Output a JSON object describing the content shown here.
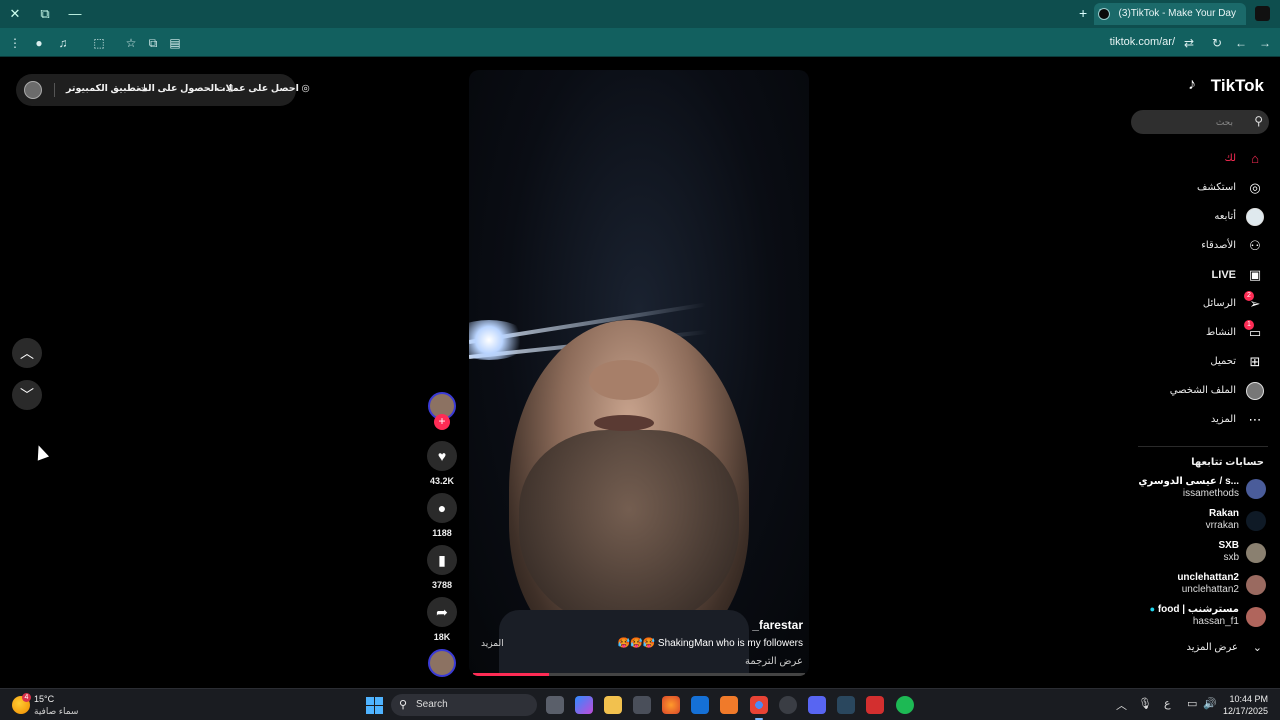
{
  "browser": {
    "tab_title": "(3)TikTok - Make Your Day",
    "url": "tiktok.com/ar/"
  },
  "topbar": {
    "promo_coins": "احصل على عملات",
    "promo_get_app": "الحصول على الت...",
    "promo_pc_app": "تطبيق الكمبيوتر"
  },
  "video": {
    "username": "_farestar",
    "caption": "🥵🥵🥵 ShakingMan who is my followers",
    "more": "المزيد",
    "translate": "عرض الترجمة",
    "progress_fraction": 0.23
  },
  "actions": {
    "likes": "43.2K",
    "comments": "1188",
    "saves": "3788",
    "shares": "18K"
  },
  "sidebar": {
    "logo": "TikTok",
    "search_placeholder": "بحث",
    "nav": [
      {
        "label": "لك",
        "icon": "home-icon"
      },
      {
        "label": "استكشف",
        "icon": "compass-icon"
      },
      {
        "label": "أتابعه",
        "icon": "following-avatar"
      },
      {
        "label": "الأصدقاء",
        "icon": "friends-icon"
      },
      {
        "label": "LIVE",
        "icon": "live-icon"
      },
      {
        "label": "الرسائل",
        "icon": "messages-icon",
        "badge": "2"
      },
      {
        "label": "النشاط",
        "icon": "activity-icon",
        "badge": "1"
      },
      {
        "label": "تحميل",
        "icon": "upload-icon"
      },
      {
        "label": "الملف الشخصي",
        "icon": "profile-avatar"
      },
      {
        "label": "المزيد",
        "icon": "more-icon"
      }
    ],
    "following_title": "حسابات تتابعها",
    "accounts": [
      {
        "name": "عيسى الدوسري / s...",
        "handle": "issamethods"
      },
      {
        "name": "Rakan",
        "handle": "vrrakan"
      },
      {
        "name": "SXB",
        "handle": "sxb"
      },
      {
        "name": "unclehattan2",
        "handle": "unclehattan2"
      },
      {
        "name": "food | مسترشنب",
        "handle": "hassan_f1",
        "verified": true
      }
    ],
    "see_more": "عرض المزيد"
  },
  "taskbar": {
    "temperature": "15°C",
    "condition": "سماء صافية",
    "weather_badge": "4",
    "search_label": "Search",
    "lang": "ع",
    "time": "10:44 PM",
    "date": "12/17/2025"
  },
  "colors": {
    "accent": "#fe2c55",
    "browser_chrome": "#12605f",
    "page_bg": "#000000"
  }
}
